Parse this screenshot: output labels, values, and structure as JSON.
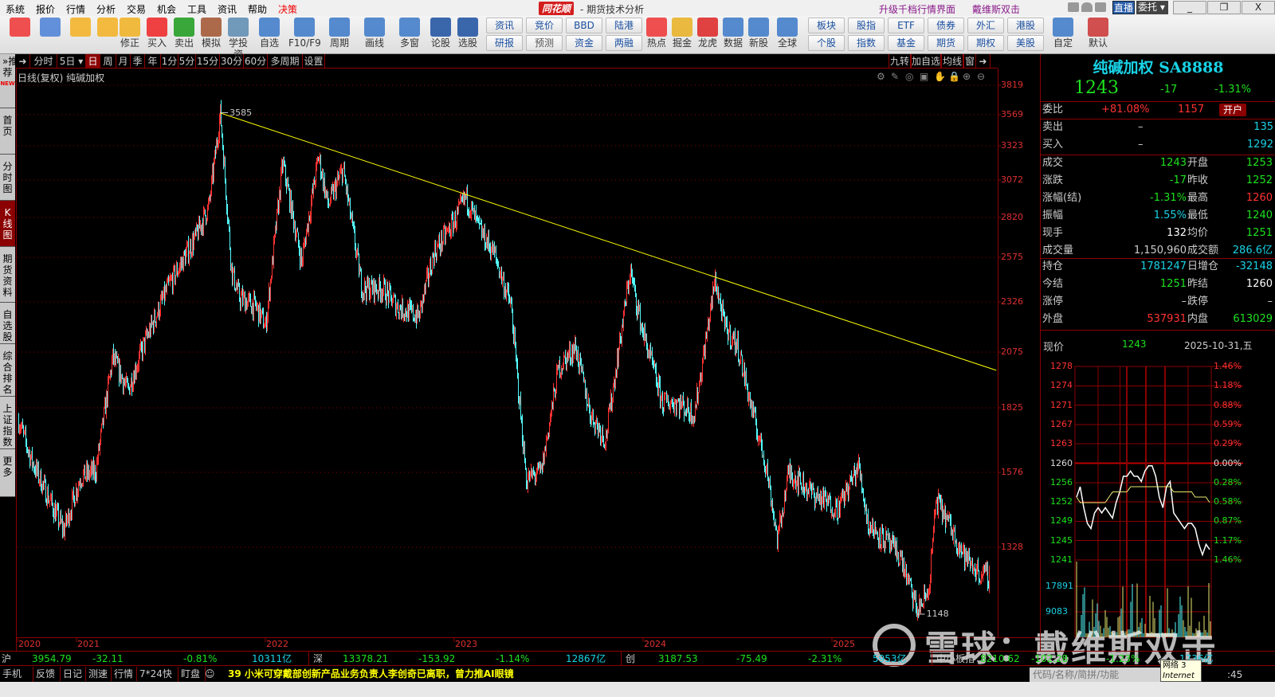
{
  "menu": {
    "items": [
      "系统",
      "报价",
      "行情",
      "分析",
      "交易",
      "机会",
      "工具",
      "资讯",
      "帮助",
      "决策"
    ],
    "logo": "同花顺",
    "app_title": "- 期货技术分析",
    "upgrade": "升级千档行情界面",
    "user": "戴维斯双击",
    "live": "直播",
    "entrust": "委托",
    "minimize": "_",
    "restore": "❐",
    "close": "X"
  },
  "toolbar": {
    "tools": [
      {
        "label": "",
        "icon": "grid-icon",
        "color": "#e33"
      },
      {
        "label": "",
        "icon": "ai-robot-icon",
        "color": "#4a7fd6"
      },
      {
        "label": "",
        "icon": "back-arrow-icon",
        "color": "#f3b020"
      },
      {
        "label": "",
        "icon": "up-down-arrow-icon",
        "color": "#f3b020"
      },
      {
        "label": "修正",
        "icon": "refresh-icon",
        "color": "#f0b020"
      },
      {
        "label": "买入",
        "icon": "buy-icon",
        "color": "#e22"
      },
      {
        "label": "卖出",
        "icon": "sell-icon",
        "color": "#1a9a1a"
      },
      {
        "label": "模拟",
        "icon": "gavel-icon",
        "color": "#a0522d"
      },
      {
        "label": "学投资",
        "icon": "graduation-cap-icon",
        "color": "#5a8ab0"
      },
      {
        "label": "自选",
        "icon": "star-folder-icon",
        "color": "#3a78c8"
      },
      {
        "label": "F10/F9",
        "icon": "document-icon",
        "color": "#3a78c8"
      },
      {
        "label": "周期",
        "icon": "clock-icon",
        "color": "#3a78c8"
      },
      {
        "label": "画线",
        "icon": "pencil-icon",
        "color": "#3a78c8"
      },
      {
        "label": "多窗",
        "icon": "windows-icon",
        "color": "#3a78c8"
      },
      {
        "label": "论股",
        "icon": "discuss-icon",
        "color": "#1a4fa0"
      },
      {
        "label": "选股",
        "icon": "search-chart-icon",
        "color": "#1a4fa0"
      }
    ],
    "pairs1": [
      [
        "资讯",
        "研报"
      ],
      [
        "竞价",
        "预测"
      ],
      [
        "BBD",
        "资金"
      ],
      [
        "陆港",
        "两融"
      ]
    ],
    "tools2": [
      {
        "label": "热点",
        "icon": "fire-icon",
        "color": "#e33"
      },
      {
        "label": "掘金",
        "icon": "gold-icon",
        "color": "#e8b020"
      },
      {
        "label": "龙虎",
        "icon": "dragon-icon",
        "color": "#d22"
      },
      {
        "label": "数据",
        "icon": "pe-icon",
        "color": "#3a78c8"
      },
      {
        "label": "新股",
        "icon": "ipo-icon",
        "color": "#3a78c8"
      },
      {
        "label": "全球",
        "icon": "globe-icon",
        "color": "#3a78c8"
      }
    ],
    "pairs2": [
      [
        "板块",
        "个股"
      ],
      [
        "股指",
        "指数"
      ],
      [
        "ETF",
        "基金"
      ],
      [
        "债券",
        "期货"
      ],
      [
        "外汇",
        "期权"
      ],
      [
        "港股",
        "美股"
      ]
    ],
    "tools3": [
      {
        "label": "自定",
        "icon": "custom-icon",
        "color": "#3a78c8"
      },
      {
        "label": "默认",
        "icon": "home-icon",
        "color": "#c33"
      }
    ]
  },
  "sidebar": {
    "items": [
      "»推荐",
      "首页",
      "分时图",
      "K线图",
      "期货资料",
      "自选股",
      "综合排名",
      "上证指数",
      "更多"
    ],
    "new_badge": "NEW",
    "active": 3
  },
  "periods": {
    "items": [
      "分时",
      "5日 ▾",
      "日",
      "周",
      "月",
      "季",
      "年",
      "1分",
      "5分",
      "15分",
      "30分",
      "60分",
      "多周期",
      "设置"
    ],
    "active": 2,
    "right": [
      "九转",
      "加自选",
      "均线",
      "窗"
    ]
  },
  "chart_title": "日线(复权) 纯碱加权",
  "chart_data": {
    "type": "candlestick",
    "title": "日线(复权) 纯碱加权",
    "scale": "log",
    "y_ticks": [
      3819,
      3569,
      3323,
      3072,
      2820,
      2575,
      2326,
      2075,
      1825,
      1576,
      1328
    ],
    "x_ticks": [
      "2020",
      "2021",
      "2022",
      "2023",
      "2024",
      "2025"
    ],
    "annotations": [
      {
        "label": "3585",
        "t": 2021.76,
        "price": 3585
      },
      {
        "label": "1148",
        "t": 2025.45,
        "price": 1148
      }
    ],
    "trendline": [
      [
        2021.76,
        3585
      ],
      [
        2025.87,
        1990
      ]
    ],
    "trendline_color": "#ffff00",
    "approx_close_path": [
      [
        2020.69,
        1780
      ],
      [
        2020.76,
        1620
      ],
      [
        2020.93,
        1380
      ],
      [
        2021.02,
        1560
      ],
      [
        2021.1,
        1580
      ],
      [
        2021.19,
        2050
      ],
      [
        2021.27,
        1900
      ],
      [
        2021.35,
        2100
      ],
      [
        2021.48,
        2400
      ],
      [
        2021.63,
        2700
      ],
      [
        2021.7,
        2900
      ],
      [
        2021.76,
        3585
      ],
      [
        2021.82,
        2500
      ],
      [
        2021.86,
        2350
      ],
      [
        2021.95,
        2300
      ],
      [
        2022.0,
        2200
      ],
      [
        2022.09,
        3200
      ],
      [
        2022.19,
        2550
      ],
      [
        2022.28,
        3250
      ],
      [
        2022.33,
        2900
      ],
      [
        2022.41,
        3150
      ],
      [
        2022.51,
        2400
      ],
      [
        2022.62,
        2400
      ],
      [
        2022.7,
        2300
      ],
      [
        2022.81,
        2250
      ],
      [
        2022.89,
        2600
      ],
      [
        2023.0,
        2800
      ],
      [
        2023.06,
        2960
      ],
      [
        2023.13,
        2750
      ],
      [
        2023.21,
        2600
      ],
      [
        2023.3,
        2300
      ],
      [
        2023.38,
        1550
      ],
      [
        2023.46,
        1580
      ],
      [
        2023.55,
        2000
      ],
      [
        2023.64,
        2100
      ],
      [
        2023.72,
        1800
      ],
      [
        2023.8,
        1700
      ],
      [
        2023.93,
        2500
      ],
      [
        2023.99,
        2200
      ],
      [
        2024.1,
        1850
      ],
      [
        2024.18,
        1850
      ],
      [
        2024.27,
        1800
      ],
      [
        2024.38,
        2450
      ],
      [
        2024.43,
        2200
      ],
      [
        2024.5,
        2100
      ],
      [
        2024.58,
        1800
      ],
      [
        2024.65,
        1600
      ],
      [
        2024.71,
        1350
      ],
      [
        2024.77,
        1580
      ],
      [
        2024.9,
        1500
      ],
      [
        2025.03,
        1450
      ],
      [
        2025.14,
        1600
      ],
      [
        2025.19,
        1400
      ],
      [
        2025.28,
        1350
      ],
      [
        2025.36,
        1300
      ],
      [
        2025.45,
        1148
      ],
      [
        2025.51,
        1200
      ],
      [
        2025.55,
        1480
      ],
      [
        2025.62,
        1400
      ],
      [
        2025.7,
        1300
      ],
      [
        2025.78,
        1250
      ],
      [
        2025.83,
        1243
      ]
    ],
    "up_color": "#ff3232",
    "down_color": "#54fcfc"
  },
  "quote": {
    "title": "纯碱加权 SA8888",
    "price": "1243",
    "change": "-17",
    "change_pct": "-1.31%",
    "weibi_label": "委比",
    "weibi_pct": "+81.08%",
    "weibi_val": "1157",
    "open_account": "开户",
    "sell_label": "卖出",
    "sell_price": "–",
    "sell_vol": "135",
    "buy_label": "买入",
    "buy_price": "–",
    "buy_vol": "1292",
    "rows": [
      {
        "l1": "成交",
        "v1": "1243",
        "c1": "g",
        "l2": "开盘",
        "v2": "1253",
        "c2": "g"
      },
      {
        "l1": "涨跌",
        "v1": "-17",
        "c1": "g",
        "l2": "昨收",
        "v2": "1252",
        "c2": "g"
      },
      {
        "l1": "涨幅(结)",
        "v1": "-1.31%",
        "c1": "g",
        "l2": "最高",
        "v2": "1260",
        "c2": "r"
      },
      {
        "l1": "振幅",
        "v1": "1.55%",
        "c1": "c",
        "l2": "最低",
        "v2": "1240",
        "c2": "g"
      },
      {
        "l1": "现手",
        "v1": "132",
        "c1": "w",
        "l2": "均价",
        "v2": "1251",
        "c2": "g"
      },
      {
        "l1": "成交量",
        "v1": "1,150,960",
        "c1": "gr",
        "l2": "成交额",
        "v2": "286.6亿",
        "c2": "c"
      }
    ],
    "rows2": [
      {
        "l1": "持仓",
        "v1": "1781247",
        "c1": "c",
        "l2": "日增仓",
        "v2": "-32148",
        "c2": "c"
      },
      {
        "l1": "今结",
        "v1": "1251",
        "c1": "g",
        "l2": "昨结",
        "v2": "1260",
        "c2": "w"
      },
      {
        "l1": "涨停",
        "v1": "–",
        "c1": "gr",
        "l2": "跌停",
        "v2": "–",
        "c2": "gr"
      },
      {
        "l1": "外盘",
        "v1": "537931",
        "c1": "r",
        "l2": "内盘",
        "v2": "613029",
        "c2": "g"
      }
    ]
  },
  "intraday": {
    "label": "现价",
    "price": "1243",
    "date": "2025-10-31,五",
    "price_ticks": [
      "1278",
      "1274",
      "1271",
      "1267",
      "1263",
      "1260",
      "1256",
      "1252",
      "1249",
      "1245",
      "1241"
    ],
    "pct_ticks": [
      "1.46%",
      "1.18%",
      "0.88%",
      "0.59%",
      "0.29%",
      "0.00%",
      "0.28%",
      "0.58%",
      "0.87%",
      "1.17%",
      "1.46%"
    ],
    "volume_ticks": [
      "17891",
      "9083"
    ],
    "price_path": [
      1253,
      1255,
      1251,
      1248,
      1247,
      1250,
      1251,
      1250,
      1251,
      1250,
      1249,
      1252,
      1254,
      1257,
      1257,
      1258,
      1257,
      1257,
      1256,
      1258,
      1259,
      1259,
      1257,
      1253,
      1251,
      1255,
      1256,
      1250,
      1249,
      1248,
      1247,
      1248,
      1248,
      1247,
      1244,
      1242,
      1244,
      1243
    ],
    "avg_path": [
      1253,
      1252,
      1252,
      1252,
      1252,
      1252,
      1252,
      1252,
      1252,
      1253,
      1254,
      1254,
      1254,
      1254,
      1254,
      1255,
      1255,
      1255,
      1255,
      1255,
      1255,
      1255,
      1255,
      1255,
      1255,
      1255,
      1255,
      1254,
      1254,
      1254,
      1254,
      1254,
      1254,
      1253,
      1253,
      1253,
      1253,
      1252
    ]
  },
  "index_bar": [
    {
      "name": "沪",
      "value": "3954.79",
      "change": "-32.11",
      "pct": "-0.81%",
      "amount": "10311亿"
    },
    {
      "name": "深",
      "value": "13378.21",
      "change": "-153.92",
      "pct": "-1.14%",
      "amount": "12867亿"
    },
    {
      "name": "创",
      "value": "3187.53",
      "change": "-75.49",
      "pct": "-2.31%",
      "amount": "5953亿"
    },
    {
      "name": "中小板指",
      "value": "8210.62",
      "change": "-102.28",
      "pct": "-1.23%",
      "amount": "1736亿"
    }
  ],
  "status": {
    "items": [
      "手机端",
      "反馈",
      "日记",
      "测速",
      "行情",
      "7*24快讯",
      "盯盘"
    ],
    "ticker": "39 小米可穿戴部创新产品业务负责人李创奇已离职，曾力推AI眼镜",
    "code_placeholder": "代码/名称/简拼/功能",
    "net_line1": "网络  3",
    "net_line2": "Internet 访问",
    "clock": ":45"
  },
  "watermark": "雪球：戴维斯双击"
}
